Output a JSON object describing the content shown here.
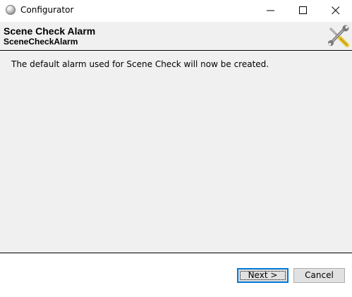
{
  "window": {
    "title": "Configurator",
    "controls": {
      "minimize_icon": "minimize-icon",
      "maximize_icon": "maximize-icon",
      "close_icon": "close-icon"
    }
  },
  "header": {
    "title": "Scene Check Alarm",
    "subtitle": "SceneCheckAlarm",
    "icon": "tools-icon"
  },
  "content": {
    "message": "The default alarm used for Scene Check will now be created."
  },
  "footer": {
    "next_label": "Next >",
    "cancel_label": "Cancel"
  },
  "colors": {
    "panel_bg": "#f0f0f0",
    "focus_border": "#0078d7",
    "button_bg": "#e1e1e1"
  }
}
